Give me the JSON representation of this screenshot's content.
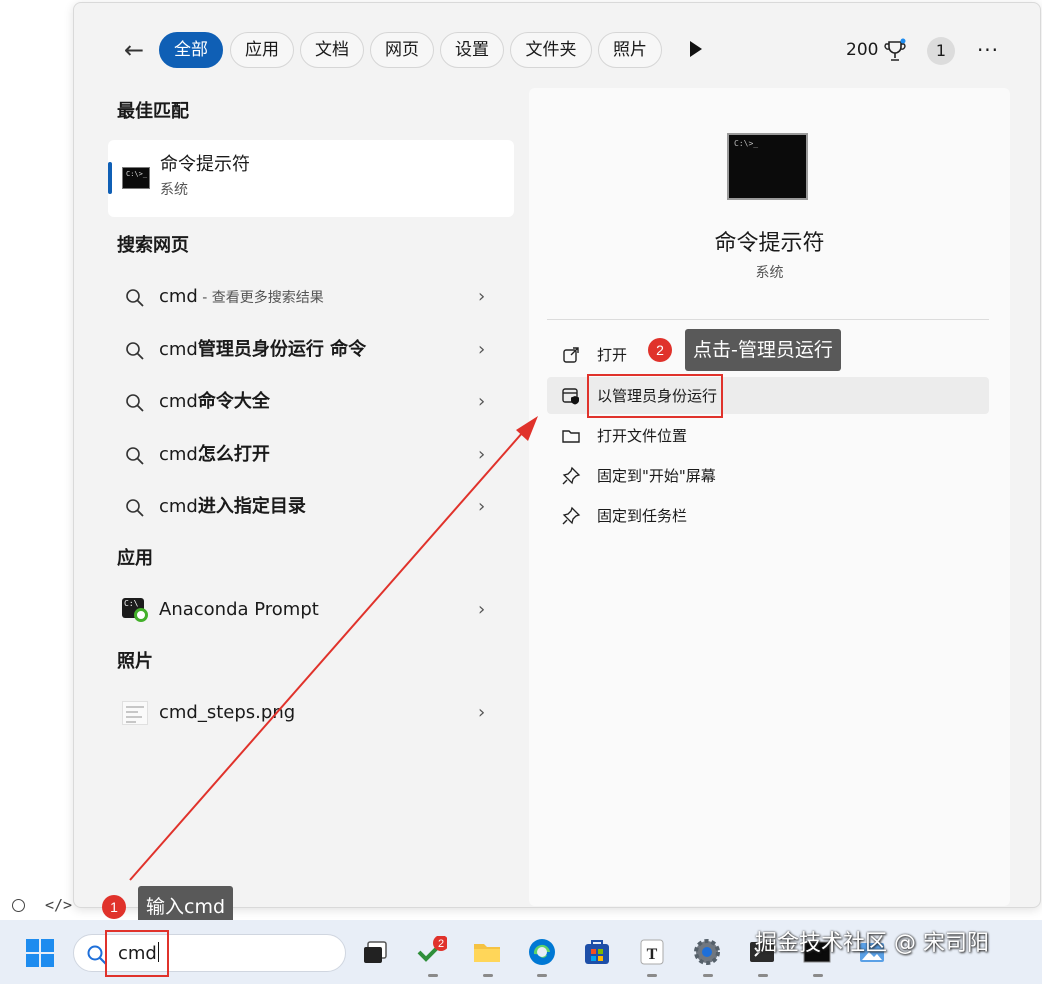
{
  "header": {
    "filters": [
      "全部",
      "应用",
      "文档",
      "网页",
      "设置",
      "文件夹",
      "照片"
    ],
    "points": "200",
    "user_badge": "1",
    "more": "···"
  },
  "best_match": {
    "title": "最佳匹配",
    "item": {
      "name": "命令提示符",
      "sub": "系统",
      "icon_text": "C:\\>_"
    }
  },
  "web_search": {
    "title": "搜索网页",
    "items": [
      {
        "prefix": "cmd",
        "bold": "",
        "hint": " - 查看更多搜索结果"
      },
      {
        "prefix": "cmd",
        "bold": "管理员身份运行 命令",
        "hint": ""
      },
      {
        "prefix": "cmd",
        "bold": "命令大全",
        "hint": ""
      },
      {
        "prefix": "cmd",
        "bold": "怎么打开",
        "hint": ""
      },
      {
        "prefix": "cmd",
        "bold": "进入指定目录",
        "hint": ""
      }
    ]
  },
  "apps": {
    "title": "应用",
    "items": [
      {
        "name": "Anaconda Prompt",
        "icon_text": "C:\\"
      }
    ]
  },
  "photos": {
    "title": "照片",
    "items": [
      {
        "name": "cmd_steps.png"
      }
    ]
  },
  "detail": {
    "title": "命令提示符",
    "sub": "系统",
    "icon_text": "C:\\>_",
    "actions": [
      "打开",
      "以管理员身份运行",
      "打开文件位置",
      "固定到\"开始\"屏幕",
      "固定到任务栏"
    ]
  },
  "annotations": {
    "step1": {
      "num": "1",
      "text": "输入cmd"
    },
    "step2": {
      "num": "2",
      "text": "点击-管理员运行"
    }
  },
  "sidebar": {
    "code_icon": "</>"
  },
  "taskbar": {
    "search_value": "cmd",
    "badge_count": "2",
    "notepad_letter": "T",
    "watermark": "掘金技术社区 @ 宋司阳"
  },
  "colors": {
    "accent": "#0f5fb5",
    "annotation_red": "#e0322b",
    "callout_bg": "#595959",
    "edge_blue": "#0078d4",
    "anaconda_green": "#43b02a"
  },
  "icons": [
    "back-arrow-icon",
    "play-icon",
    "trophy-icon",
    "search-icon",
    "chevron-right-icon",
    "open-external-icon",
    "shield-admin-icon",
    "folder-icon",
    "pin-icon",
    "windows-start-icon",
    "task-view-icon",
    "todo-check-icon",
    "file-explorer-icon",
    "edge-icon",
    "store-icon",
    "notepad-icon",
    "settings-gear-icon",
    "terminal-icon",
    "photos-icon"
  ]
}
